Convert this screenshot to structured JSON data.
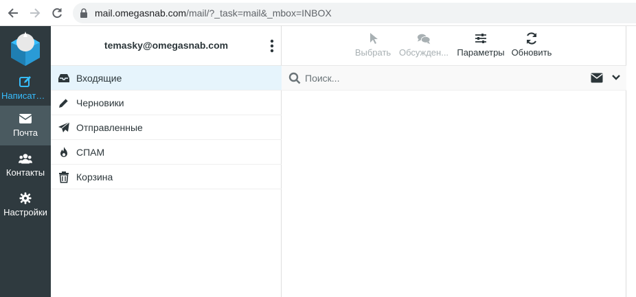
{
  "browser": {
    "url_host": "mail.omegasnab.com",
    "url_path": "/mail/?_task=mail&_mbox=INBOX"
  },
  "app_nav": {
    "items": [
      {
        "label": "Написать сообщение",
        "icon": "compose-icon",
        "active": false,
        "accent": "#37beff"
      },
      {
        "label": "Почта",
        "icon": "envelope-icon",
        "active": true
      },
      {
        "label": "Контакты",
        "icon": "contacts-icon",
        "active": false
      },
      {
        "label": "Настройки",
        "icon": "gear-icon",
        "active": false
      }
    ]
  },
  "account": {
    "email": "temasky@omegasnab.com"
  },
  "folders": [
    {
      "label": "Входящие",
      "icon": "inbox-icon",
      "selected": true
    },
    {
      "label": "Черновики",
      "icon": "pencil-icon",
      "selected": false
    },
    {
      "label": "Отправленные",
      "icon": "paper-plane-icon",
      "selected": false
    },
    {
      "label": "СПАМ",
      "icon": "fire-icon",
      "selected": false
    },
    {
      "label": "Корзина",
      "icon": "trash-icon",
      "selected": false
    }
  ],
  "toolbar": {
    "select_label": "Выбрать",
    "thread_label": "Обсужден...",
    "options_label": "Параметры",
    "refresh_label": "Обновить"
  },
  "search": {
    "placeholder": "Поиск..."
  },
  "colors": {
    "nav_bg": "#2f3a3f",
    "nav_active_bg": "#4a5a60",
    "accent": "#37beff",
    "selected_folder_bg": "#e6f4fc"
  }
}
